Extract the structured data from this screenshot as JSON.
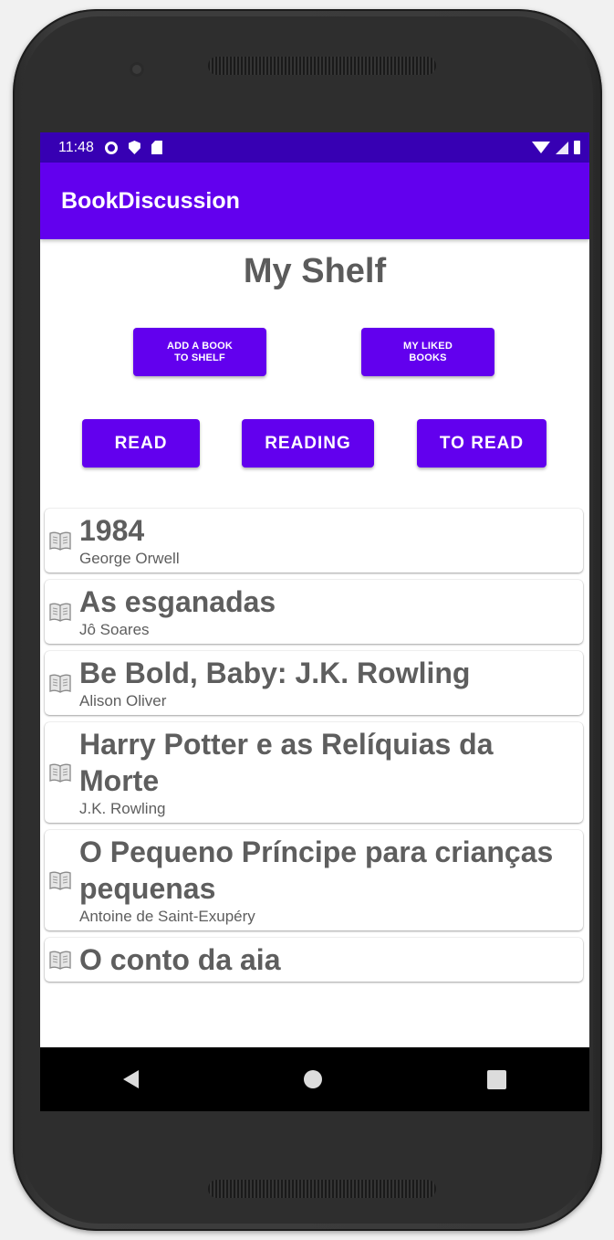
{
  "status_bar": {
    "time": "11:48",
    "icons": [
      "gear-icon",
      "shield-icon",
      "sd-card-icon"
    ],
    "right_icons": [
      "wifi-icon",
      "signal-icon",
      "battery-icon"
    ]
  },
  "app_bar": {
    "title": "BookDiscussion"
  },
  "page": {
    "title": "My Shelf"
  },
  "actions": {
    "add_book": "ADD A BOOK\nTO SHELF",
    "liked_books": "MY LIKED\nBOOKS"
  },
  "filters": {
    "read": "READ",
    "reading": "READING",
    "to_read": "TO READ"
  },
  "books": [
    {
      "title": "1984",
      "author": "George Orwell"
    },
    {
      "title": "As esganadas",
      "author": "Jô Soares"
    },
    {
      "title": "Be Bold, Baby: J.K. Rowling",
      "author": "Alison Oliver"
    },
    {
      "title": "Harry Potter e as Relíquias da Morte",
      "author": "J.K. Rowling"
    },
    {
      "title": "O Pequeno Príncipe para crianças pequenas",
      "author": "Antoine de Saint-Exupéry"
    },
    {
      "title": "O conto da aia",
      "author": ""
    }
  ],
  "colors": {
    "primary": "#6200ee",
    "primary_dark": "#3700b3",
    "text": "#5e5e5e"
  }
}
